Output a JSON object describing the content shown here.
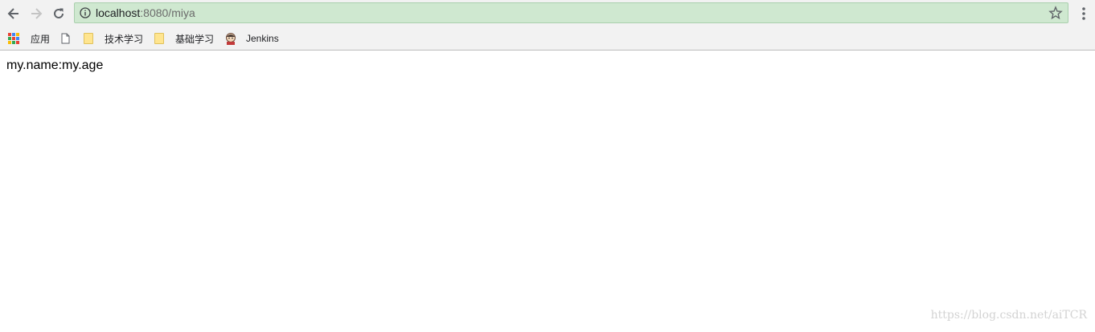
{
  "browser": {
    "url_host": "localhost",
    "url_rest": ":8080/miya"
  },
  "bookmarks": {
    "apps_label": "应用",
    "items": [
      {
        "label": "技术学习"
      },
      {
        "label": "基础学习"
      },
      {
        "label": "Jenkins"
      }
    ]
  },
  "page": {
    "body_text": "my.name:my.age"
  },
  "watermark": "https://blog.csdn.net/aiTCR",
  "colors": {
    "omnibox_bg": "#cfe8d0",
    "folder": "#ffe58f"
  }
}
